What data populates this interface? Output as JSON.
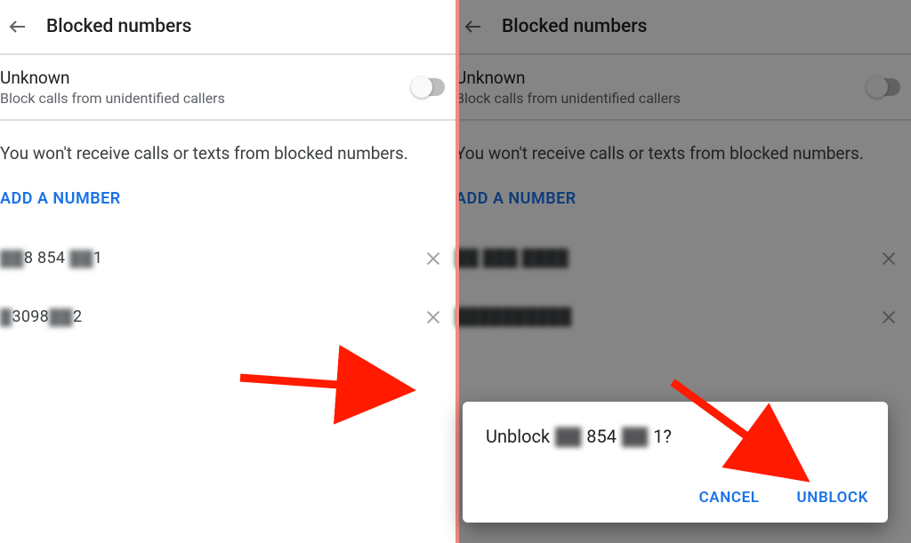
{
  "title": "Blocked numbers",
  "unknown": {
    "title": "Unknown",
    "subtitle": "Block calls from unidentified callers"
  },
  "message": "You won't receive calls or texts from blocked numbers.",
  "add_label": "ADD A NUMBER",
  "numbers": [
    {
      "prefix": "▓▓",
      "mid": "8 854",
      "tail": "▓▓",
      "last": "1"
    },
    {
      "prefix": "▓",
      "mid": "3098",
      "tail": "▓▓",
      "last": "2"
    }
  ],
  "dialog": {
    "lead": "Unblock",
    "blur1": "▓▓",
    "mid": "854",
    "blur2": "▓▓",
    "tail": "1?",
    "cancel": "CANCEL",
    "unblock": "UNBLOCK"
  }
}
